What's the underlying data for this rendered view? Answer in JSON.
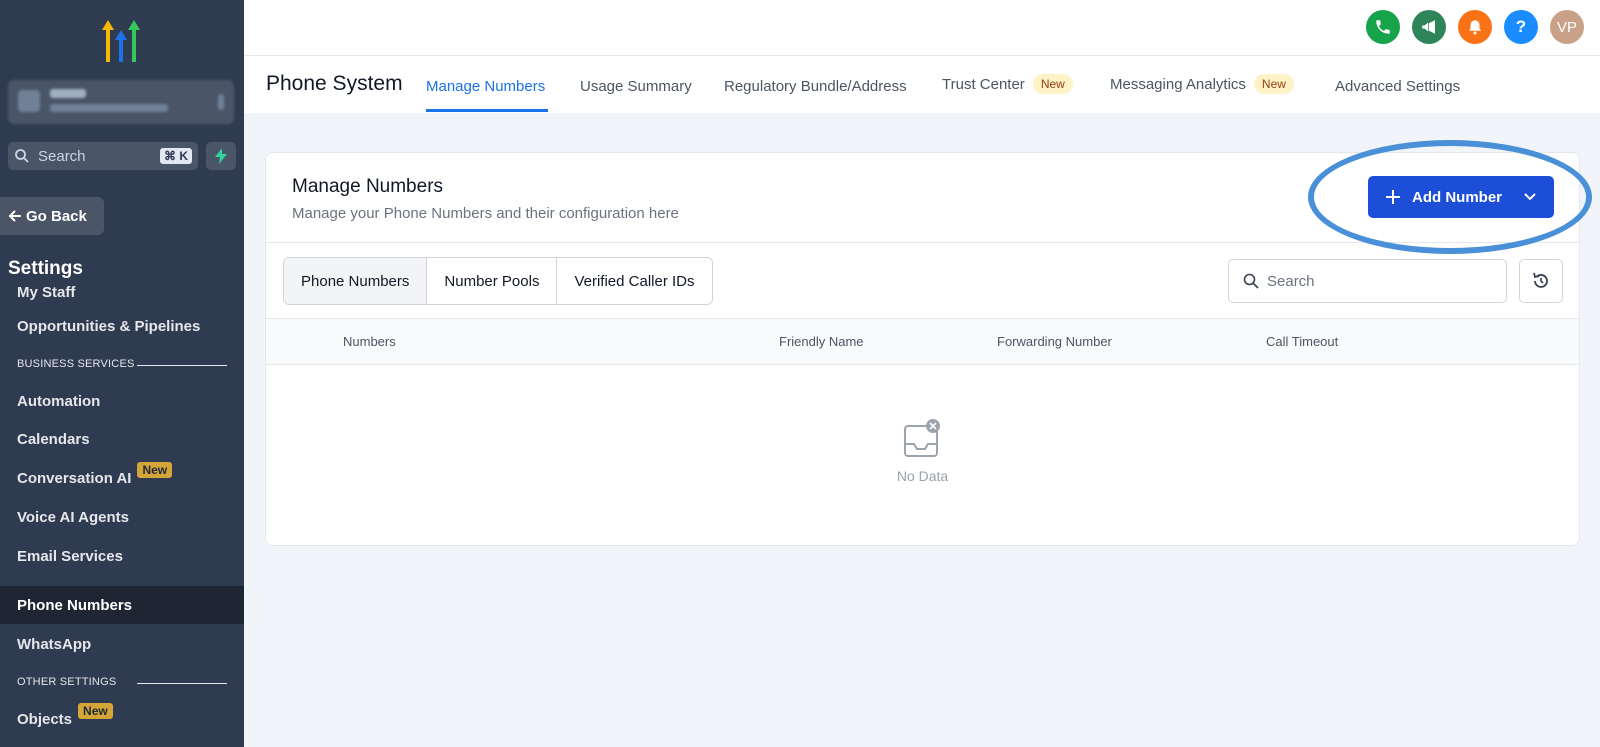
{
  "sidebar": {
    "search_placeholder": "Search",
    "search_shortcut": "⌘ K",
    "go_back": "Go Back",
    "settings_title": "Settings",
    "items": [
      {
        "label": "My Staff"
      },
      {
        "label": "Opportunities & Pipelines"
      },
      {
        "label": "Automation"
      },
      {
        "label": "Calendars"
      },
      {
        "label": "Conversation AI",
        "badge": "New"
      },
      {
        "label": "Voice AI Agents"
      },
      {
        "label": "Email Services"
      },
      {
        "label": "Phone Numbers",
        "active": true
      },
      {
        "label": "WhatsApp"
      },
      {
        "label": "Objects",
        "badge": "New"
      }
    ],
    "sections": [
      "BUSINESS SERVICES",
      "OTHER SETTINGS"
    ]
  },
  "topbar": {
    "avatar_initials": "VP",
    "help": "?",
    "icons": [
      "phone-icon",
      "megaphone-icon",
      "bell-icon",
      "help-icon",
      "avatar"
    ],
    "colors": {
      "phone": "#16a34a",
      "megaphone": "#2f855a",
      "bell": "#f97316",
      "help": "#1a8cff",
      "avatar": "#c9a088"
    }
  },
  "header": {
    "title": "Phone System",
    "tabs": [
      {
        "label": "Manage Numbers",
        "active": true
      },
      {
        "label": "Usage Summary"
      },
      {
        "label": "Regulatory Bundle/Address"
      },
      {
        "label": "Trust Center",
        "badge": "New"
      },
      {
        "label": "Messaging Analytics",
        "badge": "New"
      },
      {
        "label": "Advanced Settings"
      }
    ]
  },
  "card": {
    "title": "Manage Numbers",
    "subtitle": "Manage your Phone Numbers and their configuration here",
    "add_button": "Add Number",
    "segments": [
      {
        "label": "Phone Numbers",
        "active": true
      },
      {
        "label": "Number Pools"
      },
      {
        "label": "Verified Caller IDs"
      }
    ],
    "search_placeholder": "Search",
    "columns": [
      "Numbers",
      "Friendly Name",
      "Forwarding Number",
      "Call Timeout"
    ],
    "empty_text": "No Data"
  },
  "colors": {
    "accent": "#1a73e8",
    "primary_button": "#1d4ed8",
    "sidebar_bg": "#2f3b50",
    "highlight": "#4a90d9"
  }
}
